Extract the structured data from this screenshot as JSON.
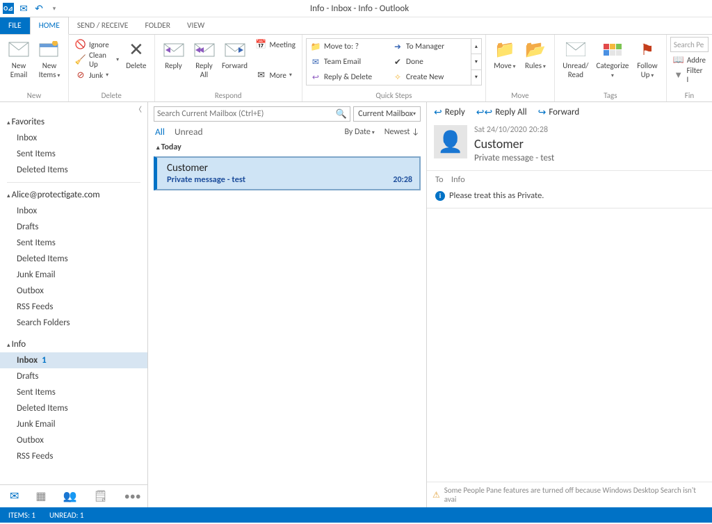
{
  "window_title": "Info - Inbox - Info - Outlook",
  "tabs": {
    "file": "FILE",
    "home": "HOME",
    "sendreceive": "SEND / RECEIVE",
    "folder": "FOLDER",
    "view": "VIEW"
  },
  "ribbon": {
    "new": {
      "label": "New",
      "new_email": "New\nEmail",
      "new_items": "New\nItems"
    },
    "delete": {
      "label": "Delete",
      "ignore": "Ignore",
      "cleanup": "Clean Up",
      "junk": "Junk",
      "delete": "Delete"
    },
    "respond": {
      "label": "Respond",
      "reply": "Reply",
      "reply_all": "Reply\nAll",
      "forward": "Forward",
      "meeting": "Meeting",
      "more": "More"
    },
    "quicksteps": {
      "label": "Quick Steps",
      "moveto": "Move to: ?",
      "team": "Team Email",
      "replydel": "Reply & Delete",
      "tomgr": "To Manager",
      "done": "Done",
      "createnew": "Create New"
    },
    "move": {
      "label": "Move",
      "move": "Move",
      "rules": "Rules"
    },
    "tags": {
      "label": "Tags",
      "unread": "Unread/\nRead",
      "categorize": "Categorize",
      "followup": "Follow\nUp"
    },
    "find": {
      "label": "Fin",
      "searchpeople": "Search Pe",
      "address": "Addre",
      "filter": "Filter I"
    }
  },
  "nav": {
    "favorites": {
      "label": "Favorites",
      "items": [
        "Inbox",
        "Sent Items",
        "Deleted Items"
      ]
    },
    "acct1": {
      "label": "Alice@protectigate.com",
      "items": [
        "Inbox",
        "Drafts",
        "Sent Items",
        "Deleted Items",
        "Junk Email",
        "Outbox",
        "RSS Feeds",
        "Search Folders"
      ]
    },
    "acct2": {
      "label": "Info",
      "items": [
        "Inbox",
        "Drafts",
        "Sent Items",
        "Deleted Items",
        "Junk Email",
        "Outbox",
        "RSS Feeds"
      ],
      "inbox_count": "1"
    }
  },
  "search": {
    "placeholder": "Search Current Mailbox (Ctrl+E)",
    "scope": "Current Mailbox"
  },
  "filters": {
    "all": "All",
    "unread": "Unread",
    "by": "By Date",
    "order": "Newest"
  },
  "list": {
    "group": "Today",
    "from": "Customer",
    "subject": "Private message - test",
    "time": "20:28"
  },
  "reading": {
    "reply": "Reply",
    "reply_all": "Reply All",
    "forward": "Forward",
    "date": "Sat 24/10/2020 20:28",
    "from": "Customer",
    "subject": "Private message - test",
    "to_label": "To",
    "to_value": "Info",
    "privacy": "Please treat this as Private.",
    "warning": "Some People Pane features are turned off because Windows Desktop Search isn't avai"
  },
  "status": {
    "items": "ITEMS: 1",
    "unread": "UNREAD: 1"
  }
}
